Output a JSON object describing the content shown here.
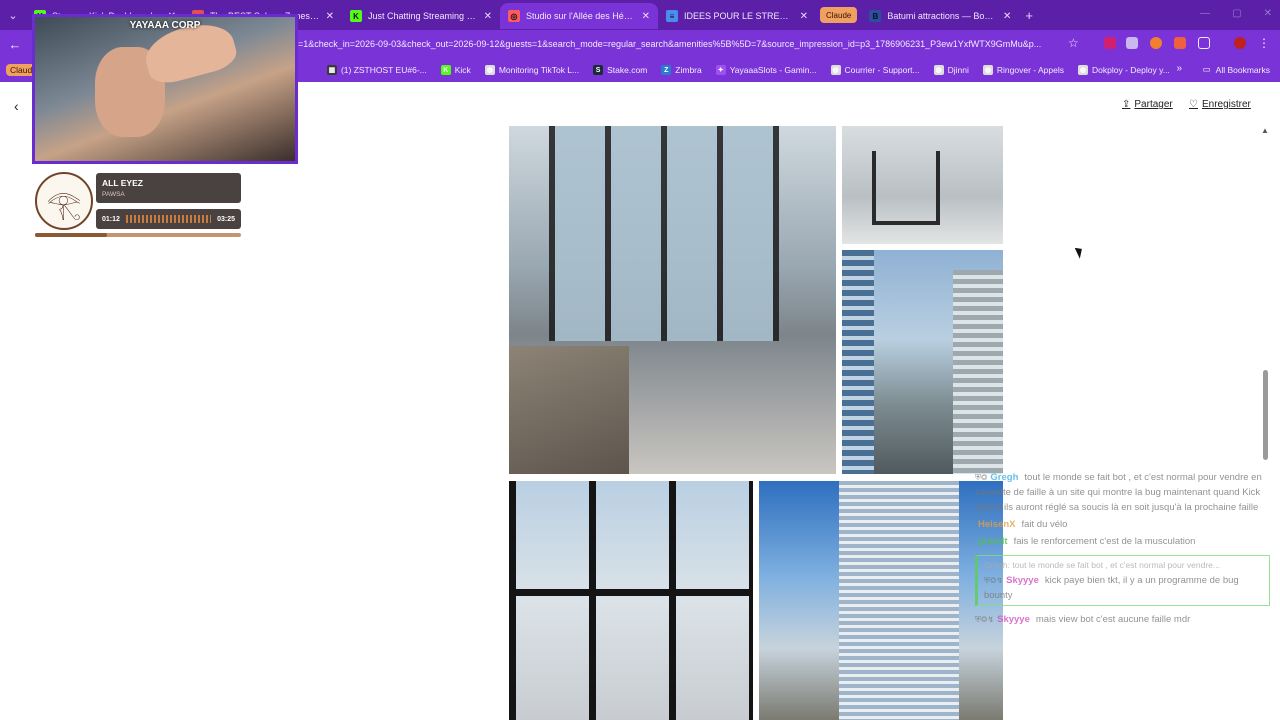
{
  "tabs": [
    {
      "title": "Stream - Kick Dashboard",
      "fav": "K",
      "color": "#53fc18",
      "active": false
    },
    {
      "title": "The BEST Sakura Zones and Th",
      "fav": "●",
      "color": "#e05050",
      "active": false
    },
    {
      "title": "Just Chatting Streaming - Live",
      "fav": "K",
      "color": "#53fc18",
      "active": false
    },
    {
      "title": "Studio sur l'Allée des Héros - A",
      "fav": "◎",
      "color": "#ff5a5f",
      "active": true
    },
    {
      "title": "IDEES POUR LE STREAM YAYA/",
      "fav": "≡",
      "color": "#4a8cf0",
      "active": false
    },
    {
      "title": "Batumi attractions — Booking",
      "fav": "B",
      "color": "#2a4ea0",
      "active": false
    }
  ],
  "tab_claude_label": "Claude",
  "url": "=1&check_in=2026-09-03&check_out=2026-09-12&guests=1&search_mode=regular_search&amenities%5B%5D=7&source_impression_id=p3_1786906231_P3ew1YxfWTX9GmMu&p...",
  "bookmarks": [
    {
      "label": "(1) ZSTHOST EU#6-...",
      "icon": "▦",
      "color": "#3a3a3a"
    },
    {
      "label": "Kick",
      "icon": "K",
      "color": "#53fc18"
    },
    {
      "label": "Monitoring TikTok L...",
      "icon": "◍",
      "color": "#dddddd"
    },
    {
      "label": "Stake.com",
      "icon": "S",
      "color": "#1a2c38"
    },
    {
      "label": "Zimbra",
      "icon": "Z",
      "color": "#2a7ad0"
    },
    {
      "label": "YayaaaSlots - Gamin...",
      "icon": "✦",
      "color": "#a050f0"
    },
    {
      "label": "Courrier - Support...",
      "icon": "◍",
      "color": "#dddddd"
    },
    {
      "label": "Djinni",
      "icon": "◍",
      "color": "#dddddd"
    },
    {
      "label": "Ringover - Appels",
      "icon": "◍",
      "color": "#dddddd"
    },
    {
      "label": "Dokploy - Deploy y...",
      "icon": "◍",
      "color": "#dddddd"
    }
  ],
  "bookmarks_claude_label": "Claude",
  "all_bookmarks_label": "All Bookmarks",
  "page": {
    "share_label": "Partager",
    "save_label": "Enregistrer"
  },
  "overlay": {
    "cam_title": "YAYAAA CORP",
    "music": {
      "song": "ALL EYEZ",
      "artist": "PAWSA",
      "elapsed": "01:12",
      "total": "03:25",
      "progress": 0.35
    }
  },
  "chat": [
    {
      "nick": "Gregh",
      "color": "#3fb0e0",
      "badges": "⛨◎",
      "text": "tout le monde se fait bot , et c'est normal pour vendre en sauvette de faille à un site qui montre la bug maintenant quand Kick paiera ils auront réglé sa soucis là en soit jusqu'à la prochaine faille"
    },
    {
      "nick": "HeisenX",
      "color": "#e0a040",
      "badges": "",
      "text": "fait du vélo"
    },
    {
      "nick": "grandt",
      "color": "#50c050",
      "badges": "",
      "text": "fais le renforcement c'est de la musculation"
    }
  ],
  "chat_reply": {
    "head": "Gregh: tout le monde se fait bot , et c'est normal pour vendre...",
    "nick": "Skyyye",
    "color": "#d050c0",
    "badges": "⛨◎↯",
    "text": "kick paye bien tkt, il y a un programme de bug bounty"
  },
  "chat_last": {
    "nick": "Skyyye",
    "color": "#d050c0",
    "badges": "⛨◎↯",
    "text": "mais view bot c'est aucune faille mdr"
  }
}
